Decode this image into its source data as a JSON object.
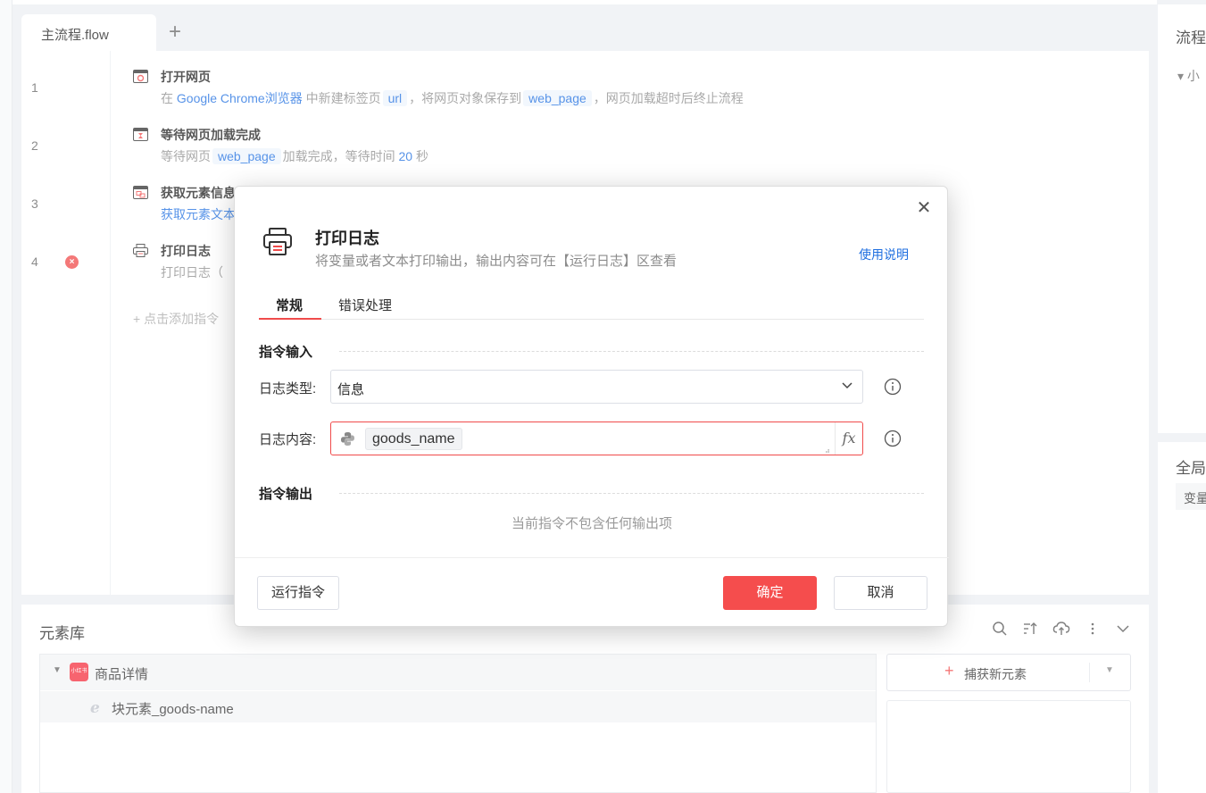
{
  "tabs": {
    "active_label": "主流程.flow",
    "add_label": "+"
  },
  "editor": {
    "lines": [
      "1",
      "2",
      "3",
      "4"
    ],
    "steps": [
      {
        "title": "打开网页",
        "desc_prefix": "在",
        "browser": "Google Chrome浏览器",
        "desc_mid1": "中新建标签页",
        "var1": "url",
        "desc_mid2": "，将网页对象保存到",
        "var2": "web_page",
        "desc_suffix": "，网页加载超时后终止流程"
      },
      {
        "title": "等待网页加载完成",
        "desc_prefix": "等待网页",
        "var1": "web_page",
        "desc_mid": "加载完成，等待时间",
        "number": "20",
        "desc_suffix": "秒"
      },
      {
        "title": "获取元素信息",
        "desc": "获取元素文本"
      },
      {
        "title": "打印日志",
        "desc": "打印日志（"
      }
    ],
    "error_mark": "×",
    "add_step": "+ 点击添加指令"
  },
  "right_panel": {
    "title_top": "流程",
    "tree_item": "▾ 小",
    "title_bottom": "全局",
    "col_header": "变量"
  },
  "element_library": {
    "title": "元素库",
    "group_name": "商品详情",
    "group_badge": "小红书",
    "element_name": "块元素_goods-name",
    "capture_button": "捕获新元素"
  },
  "dialog": {
    "title": "打印日志",
    "subtitle": "将变量或者文本打印输出，输出内容可在【运行日志】区查看",
    "help_link": "使用说明",
    "tabs": [
      "常规",
      "错误处理"
    ],
    "section_input": "指令输入",
    "log_type_label": "日志类型:",
    "log_type_value": "信息",
    "log_content_label": "日志内容:",
    "log_content_var": "goods_name",
    "fx_label": "fx",
    "section_output": "指令输出",
    "no_output": "当前指令不包含任何输出项",
    "run_button": "运行指令",
    "ok_button": "确定",
    "cancel_button": "取消"
  },
  "colors": {
    "accent_red": "#f54d4d",
    "link_blue": "#1f6fe0"
  }
}
